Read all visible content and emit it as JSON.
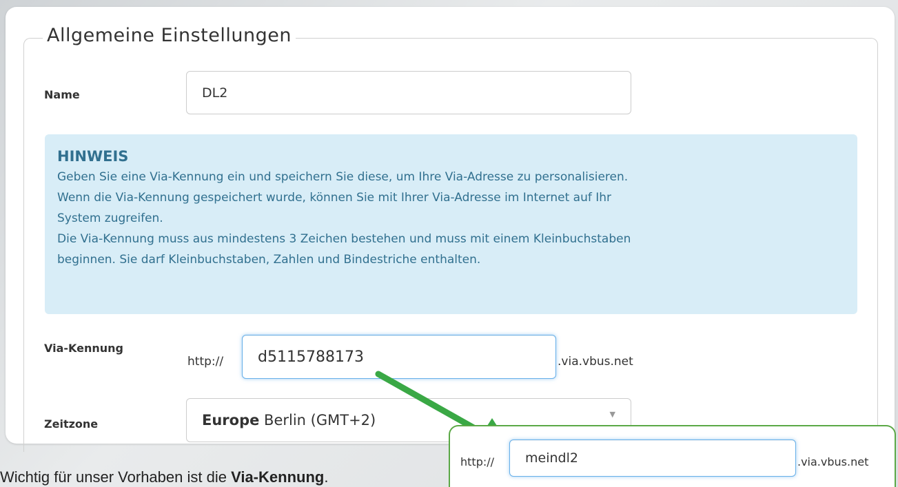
{
  "section": {
    "legend": "Allgemeine Einstellungen"
  },
  "name_field": {
    "label": "Name",
    "value": "DL2"
  },
  "hint": {
    "title": "HINWEIS",
    "lines": [
      "Geben Sie eine Via-Kennung ein und speichern Sie diese, um Ihre Via-Adresse zu personalisieren.",
      "Wenn die Via-Kennung gespeichert wurde, können Sie mit Ihrer Via-Adresse im Internet auf Ihr",
      "System zugreifen.",
      "Die Via-Kennung muss aus mindestens 3 Zeichen bestehen und muss mit einem Kleinbuchstaben",
      "beginnen. Sie darf Kleinbuchstaben, Zahlen und Bindestriche enthalten."
    ]
  },
  "via_field": {
    "label": "Via-Kennung",
    "prefix": "http://",
    "value": "d5115788173",
    "suffix": ".via.vbus.net"
  },
  "timezone": {
    "label": "Zeitzone",
    "region": "Europe",
    "city": "Berlin (GMT+2)",
    "caret_icon": "triangle-down-icon"
  },
  "callout": {
    "prefix": "http://",
    "value": "meindl2",
    "suffix": ".via.vbus.net",
    "border_color": "#5aa845",
    "arrow_color": "#3aa845"
  },
  "caption": {
    "text_before": "Wichtig für unser Vorhaben ist die ",
    "emphasis": "Via-Kennung",
    "text_after": "."
  }
}
